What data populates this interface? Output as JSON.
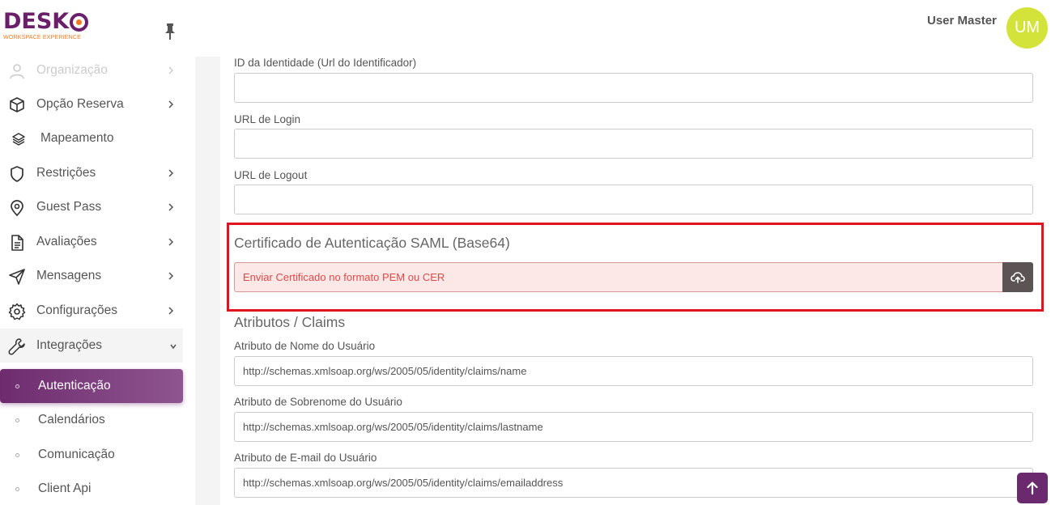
{
  "brand": {
    "name": "DESK",
    "name_last": "O",
    "tagline": "WORKSPACE EXPERIENCE"
  },
  "header": {
    "user_name": "User Master",
    "avatar_initials": "UM"
  },
  "sidebar": {
    "items": [
      {
        "label": "Organização",
        "icon": "user-icon"
      },
      {
        "label": "Opção Reserva",
        "icon": "cube-icon"
      },
      {
        "label": "Mapeamento",
        "icon": "layers-icon"
      },
      {
        "label": "Restrições",
        "icon": "shield-icon"
      },
      {
        "label": "Guest Pass",
        "icon": "map-pin-icon"
      },
      {
        "label": "Avaliações",
        "icon": "document-icon"
      },
      {
        "label": "Mensagens",
        "icon": "send-icon"
      },
      {
        "label": "Configurações",
        "icon": "gear-icon"
      },
      {
        "label": "Integrações",
        "icon": "wrench-icon"
      }
    ],
    "sub_items": [
      {
        "label": "Autenticação"
      },
      {
        "label": "Calendários"
      },
      {
        "label": "Comunicação"
      },
      {
        "label": "Client Api"
      }
    ]
  },
  "form": {
    "identity_id_label": "ID da Identidade (Url do Identificador)",
    "identity_id_value": "",
    "login_url_label": "URL de Login",
    "login_url_value": "",
    "logout_url_label": "URL de Logout",
    "logout_url_value": "",
    "certificate_title": "Certificado de Autenticação SAML (Base64)",
    "certificate_placeholder": "Enviar Certificado no formato PEM ou CER",
    "claims_title": "Atributos / Claims",
    "first_name_label": "Atributo de Nome do Usuário",
    "first_name_value": "http://schemas.xmlsoap.org/ws/2005/05/identity/claims/name",
    "last_name_label": "Atributo de Sobrenome do Usuário",
    "last_name_value": "http://schemas.xmlsoap.org/ws/2005/05/identity/claims/lastname",
    "email_label": "Atributo de E-mail do Usuário",
    "email_value": "http://schemas.xmlsoap.org/ws/2005/05/identity/claims/emailaddress"
  },
  "colors": {
    "brand_purple": "#6b1f6b",
    "brand_orange": "#f47a20",
    "avatar": "#d4e33a",
    "highlight": "#e0141e"
  }
}
